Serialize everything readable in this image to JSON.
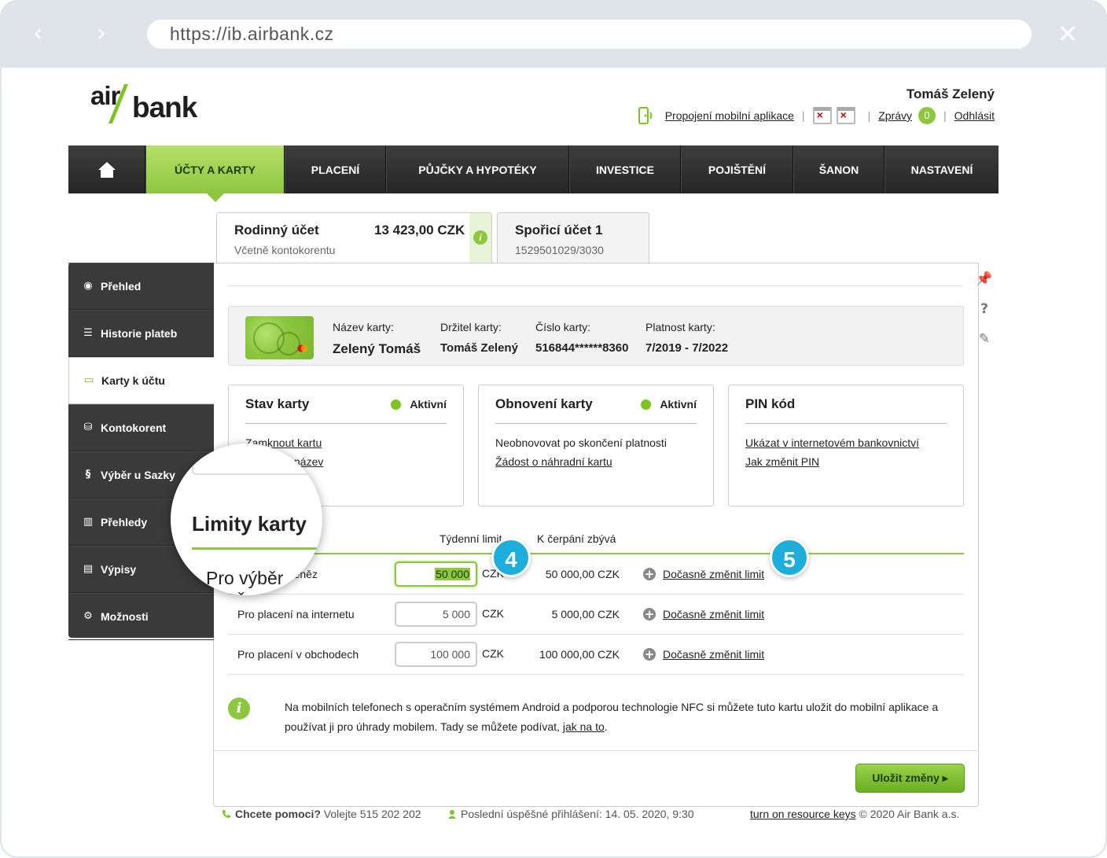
{
  "browser": {
    "url": "https://ib.airbank.cz",
    "back": "‹",
    "forward": "›",
    "close": "✕"
  },
  "header": {
    "logo_air": "air",
    "logo_bank": "bank",
    "user_name": "Tomáš Zelený",
    "mobile_link": "Propojení mobilní aplikace",
    "messages_link": "Zprávy",
    "messages_count": "0",
    "logout_link": "Odhlásit",
    "separator": "|"
  },
  "mainnav": [
    "ÚČTY A KARTY",
    "PLACENÍ",
    "PŮJČKY A HYPOTÉKY",
    "INVESTICE",
    "POJIŠTĚNÍ",
    "ŠANON",
    "NASTAVENÍ"
  ],
  "accounts": [
    {
      "name": "Rodinný účet",
      "sub": "Včetně kontokorentu",
      "amount": "13 423,00 CZK",
      "info": "i"
    },
    {
      "name": "Spořicí účet 1",
      "sub": "1529501029/3030"
    }
  ],
  "sidemenu": [
    "Přehled",
    "Historie plateb",
    "Karty k účtu",
    "Kontokorent",
    "Výběr u Sazky",
    "Přehledy",
    "Výpisy",
    "Možnosti"
  ],
  "card": {
    "name_label": "Název karty:",
    "name_value": "Zelený Tomáš",
    "holder_label": "Držitel karty:",
    "holder_value": "Tomáš Zelený",
    "number_label": "Číslo karty:",
    "number_value": "516844******8360",
    "validity_label": "Platnost karty:",
    "validity_value": "7/2019 - 7/2022"
  },
  "boxes": {
    "status": {
      "title": "Stav karty",
      "state": "Aktivní",
      "link1": "Zamknout kartu",
      "link2": "název"
    },
    "renewal": {
      "title": "Obnovení karty",
      "state": "Aktivní",
      "text1": "Neobnovovat po skončení platnosti",
      "link1": "Žádost o náhradní kartu"
    },
    "pin": {
      "title": "PIN kód",
      "link1": "Ukázat v internetovém bankovnictví",
      "link2": "Jak změnit PIN"
    }
  },
  "limits": {
    "col_weekly": "Týdenní limit",
    "col_remaining": "K čerpání zbývá",
    "rows": [
      {
        "label": "Pro výběr peněz",
        "value": "50 000",
        "currency": "CZK",
        "remaining": "50 000,00 CZK",
        "action": "Dočasně změnit limit"
      },
      {
        "label": "Pro placení na internetu",
        "value": "5 000",
        "currency": "CZK",
        "remaining": "5 000,00 CZK",
        "action": "Dočasně změnit limit"
      },
      {
        "label": "Pro placení v obchodech",
        "value": "100 000",
        "currency": "CZK",
        "remaining": "100 000,00 CZK",
        "action": "Dočasně změnit limit"
      }
    ]
  },
  "info": {
    "text": "Na mobilních telefonech s operačním systémem Android a podporou technologie NFC si můžete tuto kartu uložit do mobilní aplikace a používat ji pro úhrady mobilem. Tady se můžete podívat,",
    "link": "jak na to",
    "end": "."
  },
  "save_button": "Uložit změny ▸",
  "footer": {
    "help_bold": "Chcete pomoci?",
    "help_text": "Volejte 515 202 202",
    "last_login": "Poslední úspěšné přihlášení: 14. 05. 2020, 9:30",
    "resource_link": "turn on resource keys",
    "copyright": "© 2020 Air Bank a.s."
  },
  "magnifier": {
    "title": "Limity karty",
    "subtitle": "Pro výběr peněz"
  },
  "steps": [
    "4",
    "5"
  ],
  "colors": {
    "accent": "#8dc63f",
    "nav_dark": "#2f2f2f",
    "step_blue": "#1eaedb"
  }
}
